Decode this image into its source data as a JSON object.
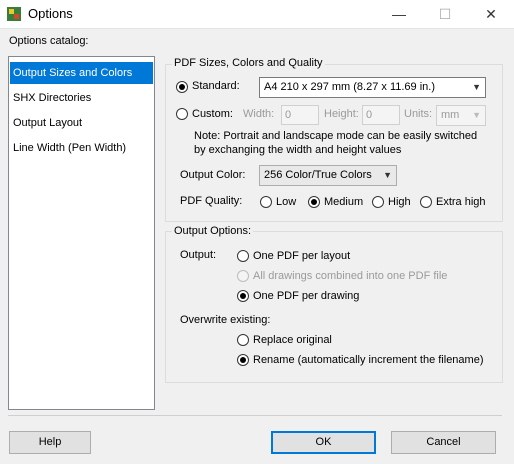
{
  "window": {
    "title": "Options",
    "minimize": "—",
    "maximize": "☐",
    "close": "✕"
  },
  "catalog": {
    "label": "Options catalog:",
    "items": [
      "Output Sizes and Colors",
      "SHX Directories",
      "Output Layout",
      "Line Width (Pen Width)"
    ]
  },
  "pdf": {
    "group_title": "PDF Sizes, Colors and Quality",
    "standard_label": "Standard:",
    "standard_value": "A4 210 x 297 mm (8.27 x 11.69 in.)",
    "custom_label": "Custom:",
    "width_label": "Width:",
    "width_value": "0",
    "height_label": "Height:",
    "height_value": "0",
    "units_label": "Units:",
    "units_value": "mm",
    "note_line1": "Note: Portrait and landscape mode can be easily switched",
    "note_line2": "by exchanging the width and height values",
    "color_label": "Output Color:",
    "color_value": "256 Color/True Colors",
    "quality_label": "PDF Quality:",
    "quality_low": "Low",
    "quality_medium": "Medium",
    "quality_high": "High",
    "quality_extra": "Extra high"
  },
  "output": {
    "group_title": "Output Options:",
    "output_label": "Output:",
    "one_per_layout": "One PDF per layout",
    "all_combined": "All drawings combined into one PDF file",
    "one_per_drawing": "One PDF per drawing",
    "overwrite_label": "Overwrite existing:",
    "replace": "Replace original",
    "rename": "Rename (automatically increment the filename)"
  },
  "buttons": {
    "help": "Help",
    "ok": "OK",
    "cancel": "Cancel"
  }
}
